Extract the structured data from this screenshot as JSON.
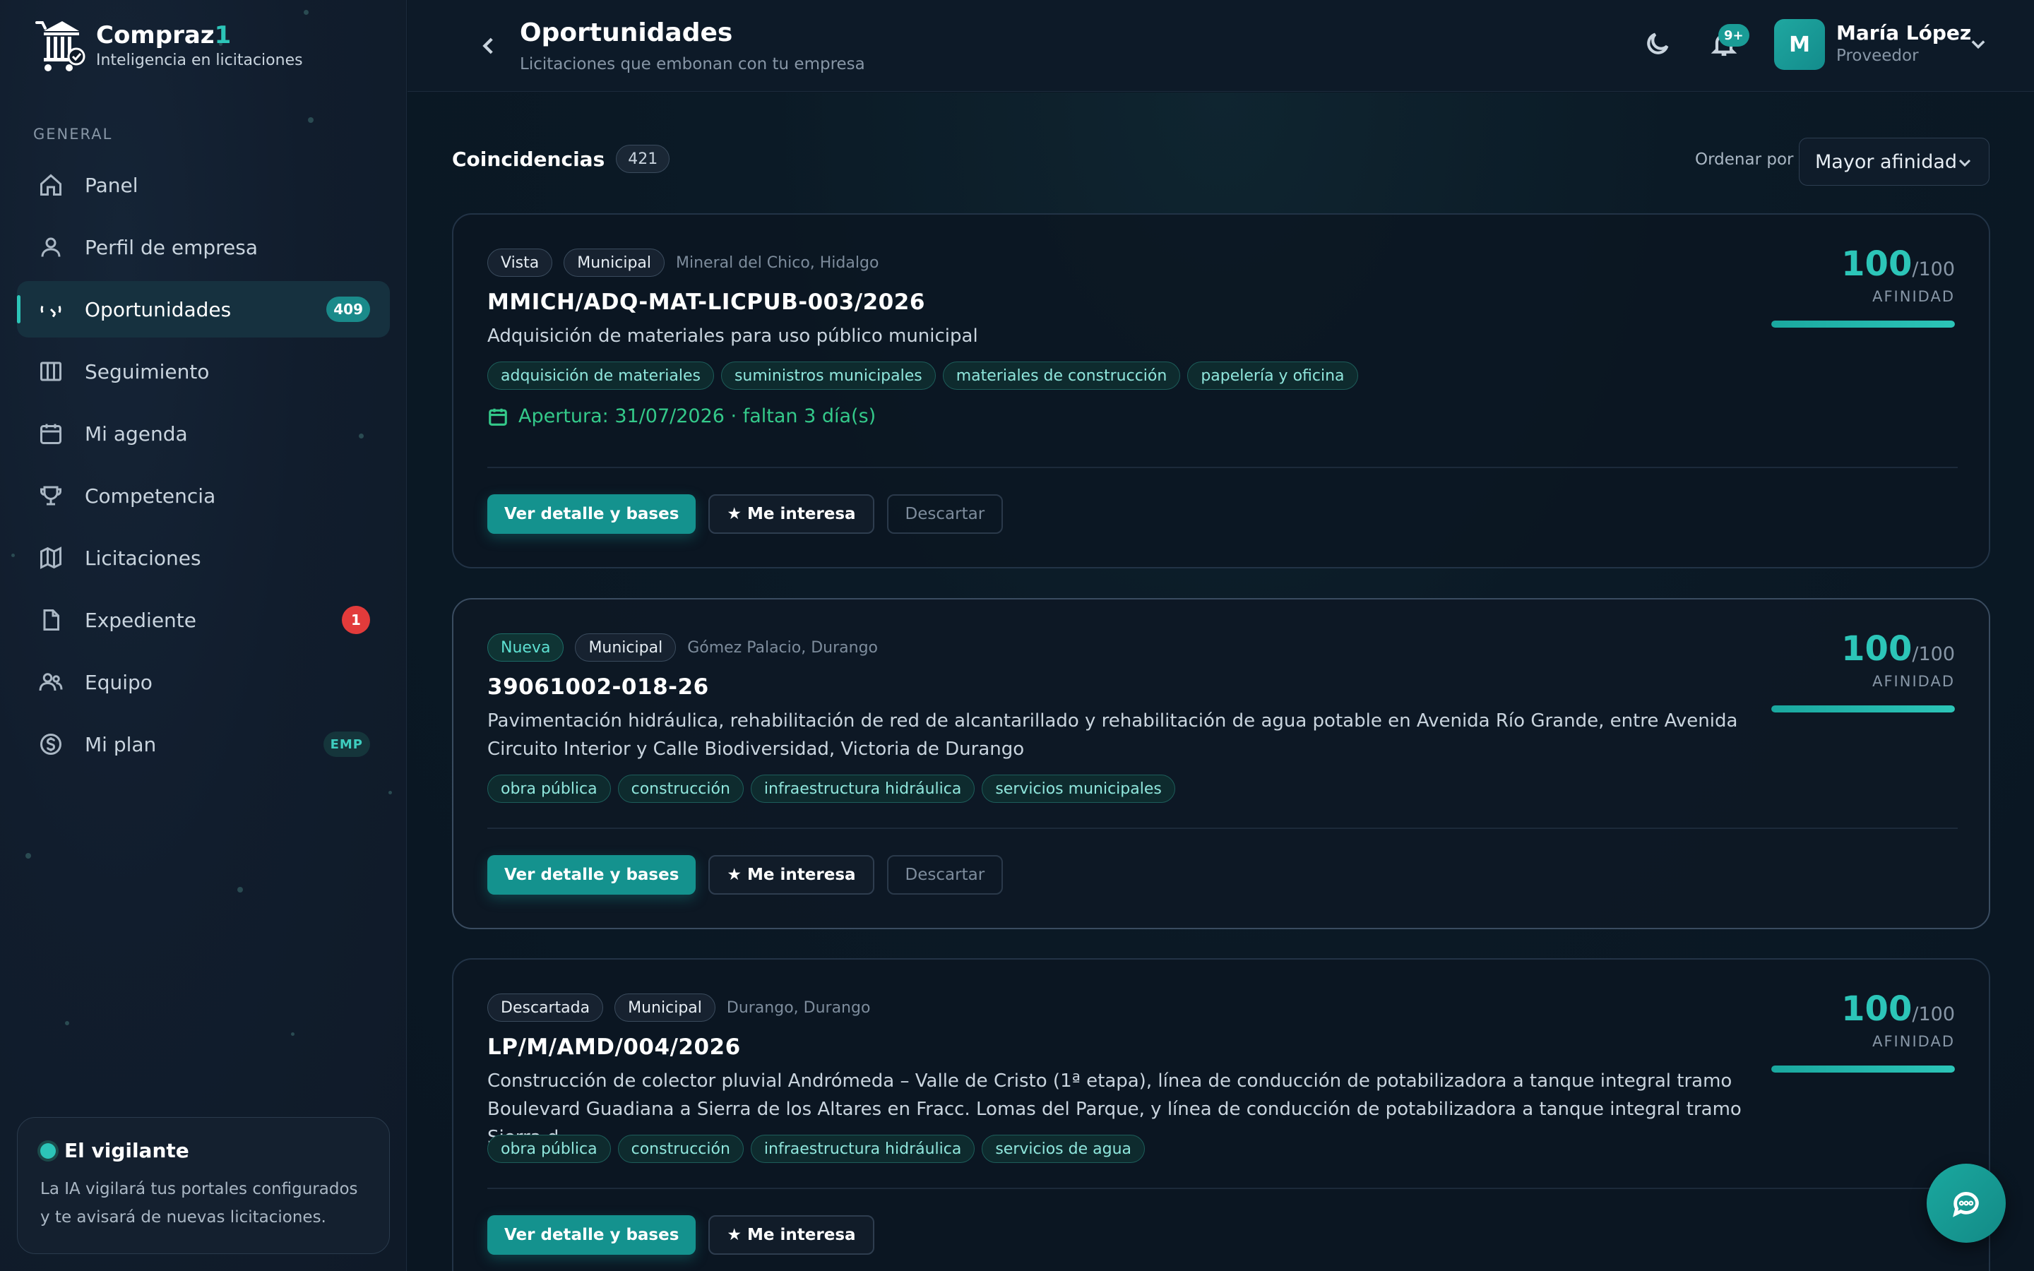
{
  "brand": {
    "name_main": "Compraz",
    "name_accent": "1",
    "tagline": "Inteligencia en licitaciones"
  },
  "sidebar": {
    "section_label": "GENERAL",
    "items": [
      {
        "label": "Panel",
        "icon": "home-icon"
      },
      {
        "label": "Perfil de empresa",
        "icon": "user-icon"
      },
      {
        "label": "Oportunidades",
        "icon": "radar-icon",
        "badge": "409",
        "active": true
      },
      {
        "label": "Seguimiento",
        "icon": "columns-icon"
      },
      {
        "label": "Mi agenda",
        "icon": "calendar-icon"
      },
      {
        "label": "Competencia",
        "icon": "trophy-icon"
      },
      {
        "label": "Licitaciones",
        "icon": "map-icon"
      },
      {
        "label": "Expediente",
        "icon": "file-icon",
        "badge": "1"
      },
      {
        "label": "Equipo",
        "icon": "users-icon"
      },
      {
        "label": "Mi plan",
        "icon": "dollar-icon",
        "badge": "EMP"
      }
    ],
    "vigilante": {
      "title": "El vigilante",
      "text": "La IA vigilará tus portales configurados y te avisará de nuevas licitaciones."
    }
  },
  "header": {
    "title": "Oportunidades",
    "subtitle": "Licitaciones que embonan con tu empresa",
    "notifications_badge": "9+",
    "user": {
      "initial": "M",
      "name": "María López",
      "role": "Proveedor"
    }
  },
  "main": {
    "coincidences_label": "Coincidencias",
    "coincidences_count": "421",
    "order_label": "Ordenar por",
    "order_value": "Mayor afinidad",
    "cards": [
      {
        "status": "Vista",
        "type": "Municipal",
        "location": "Mineral del Chico, Hidalgo",
        "code": "MMICH/ADQ-MAT-LICPUB-003/2026",
        "description": "Adquisición de materiales para uso público municipal",
        "keywords": [
          "adquisición de materiales",
          "suministros municipales",
          "materiales de construcción",
          "papelería y oficina"
        ],
        "apertura": "Apertura: 31/07/2026 · faltan 3 día(s)",
        "score": "100",
        "score_max": "/100",
        "score_label": "AFINIDAD",
        "score_fraction": 1.0,
        "btn_detail": "Ver detalle y bases",
        "btn_interest": "★ Me interesa",
        "btn_discard": "Descartar"
      },
      {
        "status": "Nueva",
        "type": "Municipal",
        "location": "Gómez Palacio, Durango",
        "code": "39061002-018-26",
        "description": "Pavimentación hidráulica, rehabilitación de red de alcantarillado y rehabilitación de agua potable en Avenida Río Grande, entre Avenida Circuito Interior y Calle Biodiversidad, Victoria de Durango",
        "keywords": [
          "obra pública",
          "construcción",
          "infraestructura hidráulica",
          "servicios municipales"
        ],
        "score": "100",
        "score_max": "/100",
        "score_label": "AFINIDAD",
        "score_fraction": 1.0,
        "btn_detail": "Ver detalle y bases",
        "btn_interest": "★ Me interesa",
        "btn_discard": "Descartar"
      },
      {
        "status": "Descartada",
        "type": "Municipal",
        "location": "Durango, Durango",
        "code": "LP/M/AMD/004/2026",
        "description": "Construcción de colector pluvial Andrómeda – Valle de Cristo (1ª etapa), línea de conducción de potabilizadora a tanque integral tramo Boulevard Guadiana a Sierra de los Altares en Fracc. Lomas del Parque, y línea de conducción de potabilizadora a tanque integral tramo Sierra d...",
        "keywords": [
          "obra pública",
          "construcción",
          "infraestructura hidráulica",
          "servicios de agua"
        ],
        "score": "100",
        "score_max": "/100",
        "score_label": "AFINIDAD",
        "score_fraction": 1.0,
        "btn_detail": "Ver detalle y bases",
        "btn_interest": "★ Me interesa"
      }
    ]
  },
  "colors": {
    "accent": "#2cc5b8",
    "background": "#0b1724",
    "success": "#34c98a",
    "danger": "#e23b3b"
  }
}
